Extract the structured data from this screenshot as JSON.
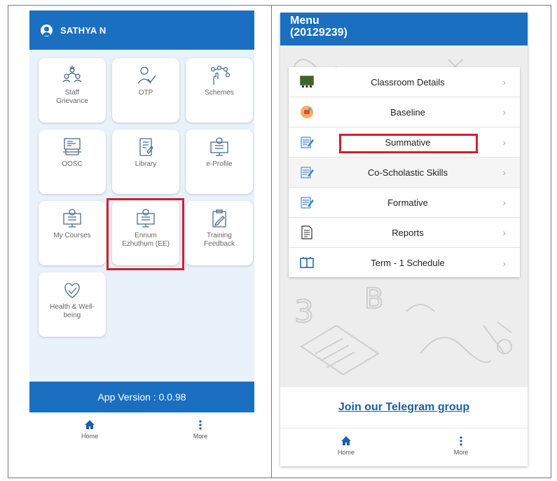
{
  "left_screen": {
    "user_name": "SATHYA N",
    "tiles": [
      {
        "label": "Staff\nGrievance",
        "icon": "staff-grievance-icon"
      },
      {
        "label": "OTP",
        "icon": "otp-icon"
      },
      {
        "label": "Schemes",
        "icon": "schemes-icon"
      },
      {
        "label": "OOSC",
        "icon": "oosc-icon"
      },
      {
        "label": "Library",
        "icon": "library-icon"
      },
      {
        "label": "e-Profile",
        "icon": "e-profile-icon"
      },
      {
        "label": "My Courses",
        "icon": "my-courses-icon"
      },
      {
        "label": "Ennum\nEzhuthum (EE)",
        "icon": "ennum-ezhuthum-icon"
      },
      {
        "label": "Training\nFeedback",
        "icon": "training-feedback-icon"
      },
      {
        "label": "Health & Well-\nbeing",
        "icon": "health-wellbeing-icon"
      }
    ],
    "app_version": "App Version : 0.0.98",
    "nav": {
      "home": "Home",
      "more": "More"
    }
  },
  "right_screen": {
    "title_line1": "Menu",
    "title_line2": "(20129239)",
    "menu_items": [
      {
        "label": "Classroom Details",
        "icon": "classroom-icon"
      },
      {
        "label": "Baseline",
        "icon": "baseline-icon"
      },
      {
        "label": "Summative",
        "icon": "summative-icon"
      },
      {
        "label": "Co-Scholastic Skills",
        "icon": "co-scholastic-icon"
      },
      {
        "label": "Formative",
        "icon": "formative-icon"
      },
      {
        "label": "Reports",
        "icon": "reports-icon"
      },
      {
        "label": "Term - 1 Schedule",
        "icon": "schedule-icon"
      }
    ],
    "chevron": "›",
    "telegram_link": "Join our Telegram group",
    "nav": {
      "home": "Home",
      "more": "More"
    }
  },
  "colors": {
    "brand_blue": "#1b6fc0",
    "highlight_red": "#d0202d",
    "tile_bg": "#e9f1fa",
    "link_blue": "#1b5fa6"
  }
}
